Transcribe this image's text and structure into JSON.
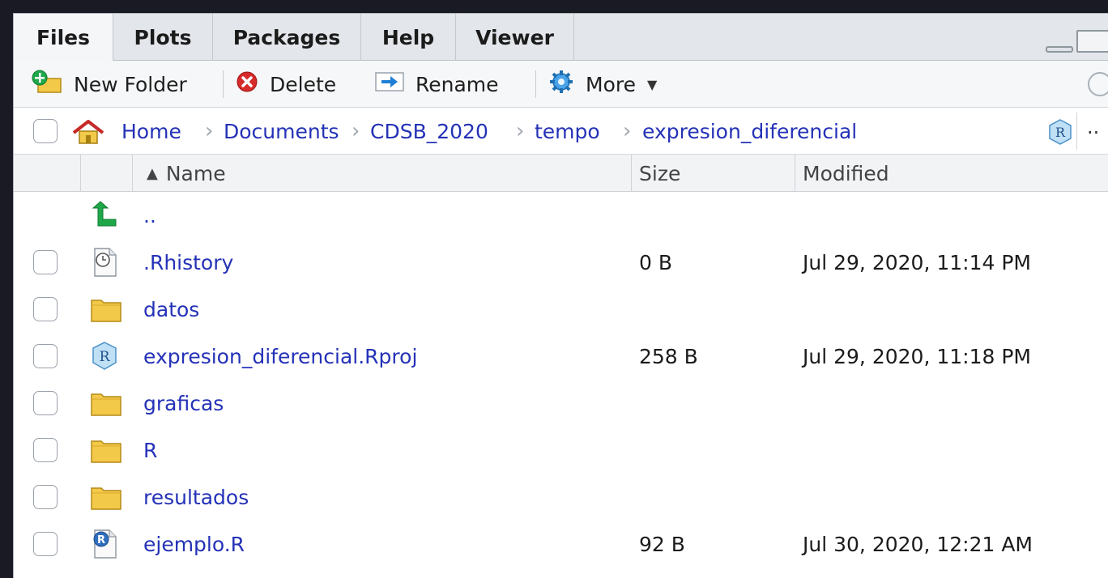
{
  "tabs": [
    {
      "label": "Files",
      "active": true
    },
    {
      "label": "Plots",
      "active": false
    },
    {
      "label": "Packages",
      "active": false
    },
    {
      "label": "Help",
      "active": false
    },
    {
      "label": "Viewer",
      "active": false
    }
  ],
  "toolbar": {
    "new_folder": "New Folder",
    "delete": "Delete",
    "rename": "Rename",
    "more": "More"
  },
  "breadcrumb": [
    "Home",
    "Documents",
    "CDSB_2020",
    "tempo",
    "expresion_diferencial"
  ],
  "path_more": "..",
  "columns": {
    "name": "Name",
    "size": "Size",
    "modified": "Modified"
  },
  "sort": {
    "column": "Name",
    "direction": "ascending"
  },
  "files": [
    {
      "name": "..",
      "size": "",
      "modified": "",
      "icon": "up-arrow-icon"
    },
    {
      "name": ".Rhistory",
      "size": "0 B",
      "modified": "Jul 29, 2020, 11:14 PM",
      "icon": "history-file-icon"
    },
    {
      "name": "datos",
      "size": "",
      "modified": "",
      "icon": "folder-icon"
    },
    {
      "name": "expresion_diferencial.Rproj",
      "size": "258 B",
      "modified": "Jul 29, 2020, 11:18 PM",
      "icon": "rproj-file-icon"
    },
    {
      "name": "graficas",
      "size": "",
      "modified": "",
      "icon": "folder-icon"
    },
    {
      "name": "R",
      "size": "",
      "modified": "",
      "icon": "folder-icon"
    },
    {
      "name": "resultados",
      "size": "",
      "modified": "",
      "icon": "folder-icon"
    },
    {
      "name": "ejemplo.R",
      "size": "92 B",
      "modified": "Jul 30, 2020, 12:21 AM",
      "icon": "r-script-icon"
    }
  ],
  "colors": {
    "link": "#2432b7",
    "folder": "#f3c94a",
    "up_arrow": "#1fa84a",
    "delete": "#d62b2b"
  }
}
